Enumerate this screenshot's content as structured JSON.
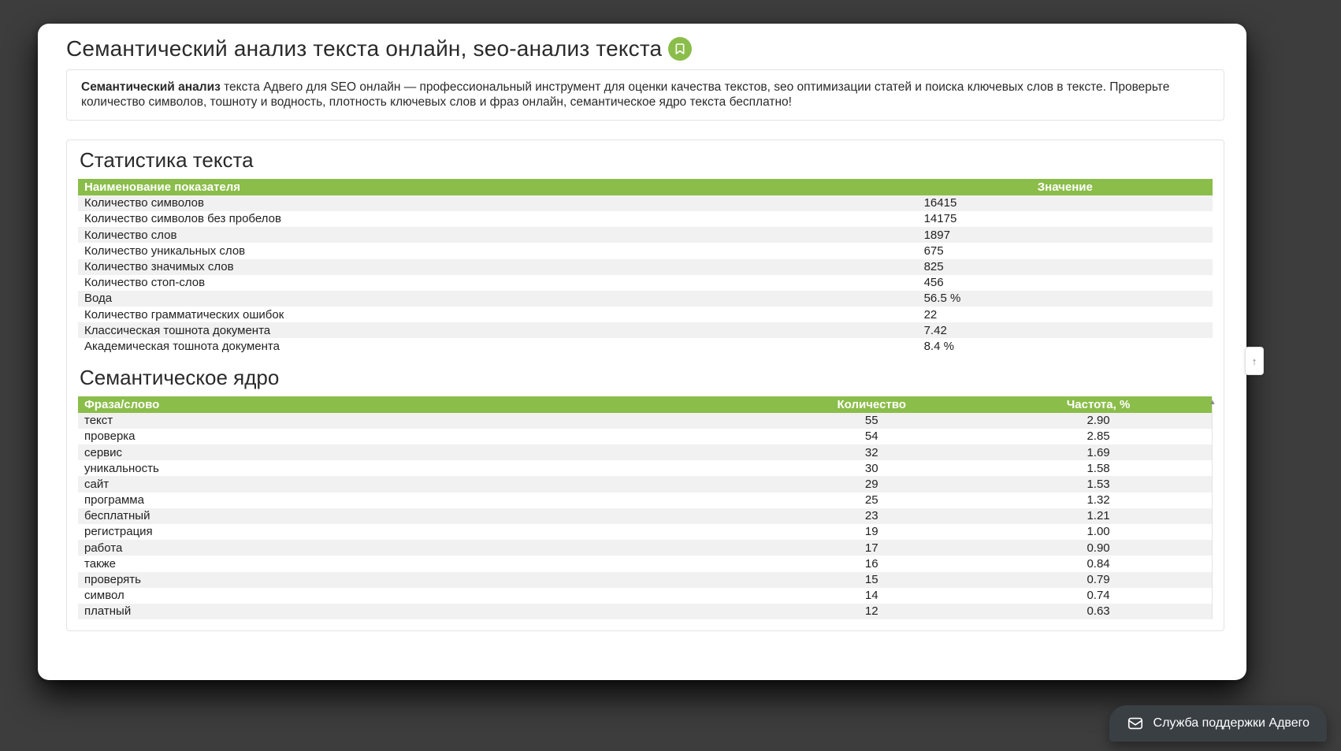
{
  "page": {
    "title": "Семантический анализ текста онлайн, seo-анализ текста"
  },
  "intro": {
    "lead_strong": "Семантический анализ",
    "rest": " текста Адвего для SEO онлайн — профессиональный инструмент для оценки качества текстов, seo оптимизации статей и поиска ключевых слов в тексте. Проверьте количество символов, тошноту и водность, плотность ключевых слов и фраз онлайн, семантическое ядро текста бесплатно!"
  },
  "stats": {
    "title": "Статистика текста",
    "headers": {
      "name": "Наименование показателя",
      "value": "Значение"
    },
    "rows": [
      {
        "name": "Количество символов",
        "value": "16415"
      },
      {
        "name": "Количество символов без пробелов",
        "value": "14175"
      },
      {
        "name": "Количество слов",
        "value": "1897"
      },
      {
        "name": "Количество уникальных слов",
        "value": "675"
      },
      {
        "name": "Количество значимых слов",
        "value": "825"
      },
      {
        "name": "Количество стоп-слов",
        "value": "456"
      },
      {
        "name": "Вода",
        "value": "56.5 %"
      },
      {
        "name": "Количество грамматических ошибок",
        "value": "22"
      },
      {
        "name": "Классическая тошнота документа",
        "value": "7.42"
      },
      {
        "name": "Академическая тошнота документа",
        "value": "8.4 %"
      }
    ]
  },
  "core": {
    "title": "Семантическое ядро",
    "headers": {
      "word": "Фраза/слово",
      "count": "Количество",
      "freq": "Частота, %"
    },
    "rows": [
      {
        "word": "текст",
        "count": "55",
        "freq": "2.90"
      },
      {
        "word": "проверка",
        "count": "54",
        "freq": "2.85"
      },
      {
        "word": "сервис",
        "count": "32",
        "freq": "1.69"
      },
      {
        "word": "уникальность",
        "count": "30",
        "freq": "1.58"
      },
      {
        "word": "сайт",
        "count": "29",
        "freq": "1.53"
      },
      {
        "word": "программа",
        "count": "25",
        "freq": "1.32"
      },
      {
        "word": "бесплатный",
        "count": "23",
        "freq": "1.21"
      },
      {
        "word": "регистрация",
        "count": "19",
        "freq": "1.00"
      },
      {
        "word": "работа",
        "count": "17",
        "freq": "0.90"
      },
      {
        "word": "также",
        "count": "16",
        "freq": "0.84"
      },
      {
        "word": "проверять",
        "count": "15",
        "freq": "0.79"
      },
      {
        "word": "символ",
        "count": "14",
        "freq": "0.74"
      },
      {
        "word": "платный",
        "count": "12",
        "freq": "0.63"
      }
    ]
  },
  "support": {
    "label": "Служба поддержки Адвего"
  },
  "toptab": {
    "label": "↑"
  }
}
